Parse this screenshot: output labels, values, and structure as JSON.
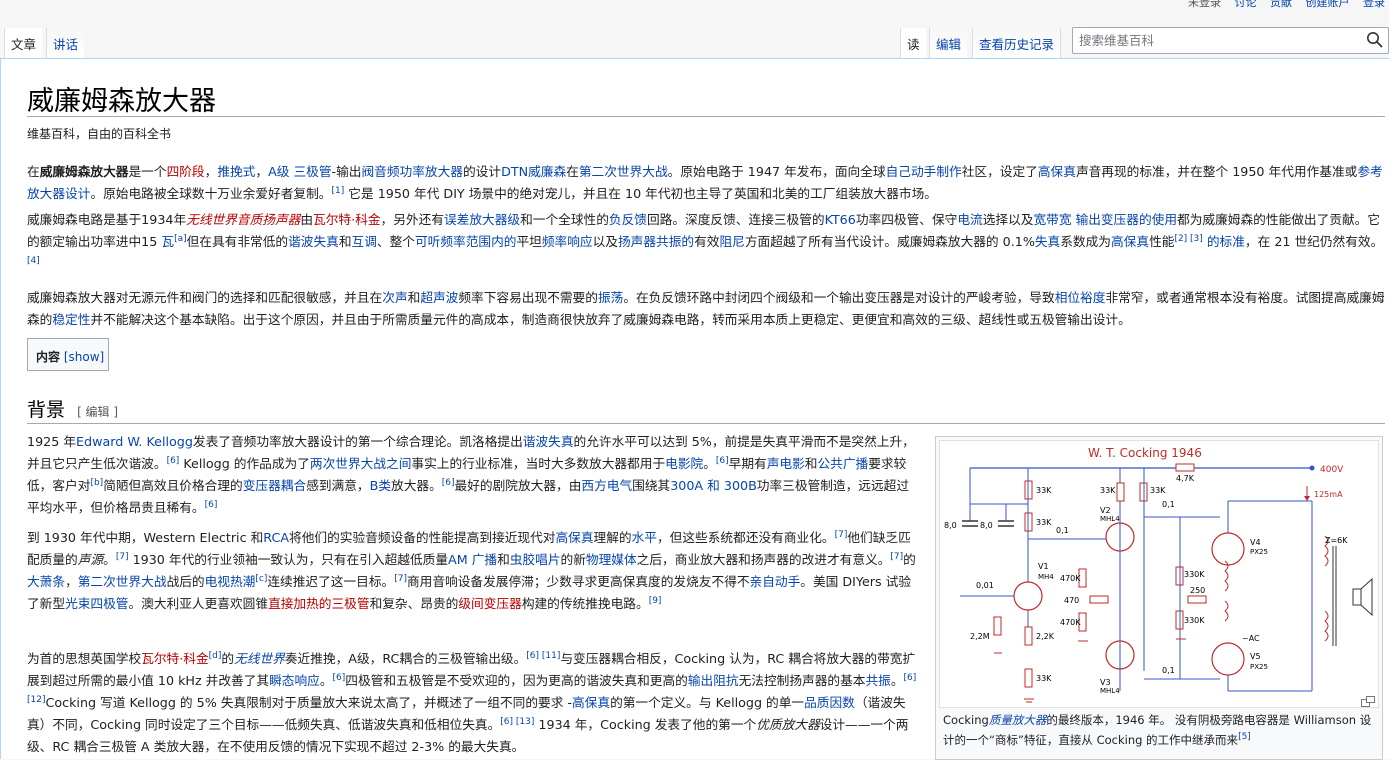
{
  "personal_tools": [
    "未登录",
    "讨论",
    "贡献",
    "创建账户",
    "登录"
  ],
  "tabs": {
    "article": "文章",
    "talk": "讲话",
    "read": "读",
    "edit": "编辑",
    "history": "查看历史记录"
  },
  "search": {
    "placeholder": "搜索维基百科"
  },
  "page": {
    "title": "威廉姆森放大器",
    "tagline": "维基百科，自由的百科全书"
  },
  "toc": {
    "label": "内容",
    "toggle": "[show]"
  },
  "section": {
    "title": "背景",
    "edit": "[ 编辑 ]"
  },
  "figure": {
    "diagram_title": "W. T. Cocking 1946",
    "caption_pre": "Cocking",
    "caption_em": "质量放大器",
    "caption_post": "的最终版本，1946 年。 没有阴极旁路电容器是 Williamson 设计的一个“商标”特征，直接从 Cocking 的工作中继承而来",
    "caption_ref": "[5]",
    "labels": {
      "v400": "400V",
      "ma125": "125mA",
      "k47": "4,7K",
      "z6k": "Z=6K",
      "ac": "~AC",
      "k33": "33K",
      "c01": "0,1",
      "c8": "8,0",
      "c001": "0,01",
      "r22m": "2,2M",
      "r22k": "2,2K",
      "k470": "470K",
      "r470": "470",
      "k330": "330K",
      "r250": "250",
      "v1": "V1",
      "mh4": "MH4",
      "v2": "V2",
      "v3": "V3",
      "v4": "V4",
      "v5": "V5",
      "px25": "PX25"
    }
  },
  "colors": {
    "link": "#0645ad",
    "redlink": "#ba0000",
    "circuit": "#c22a2a",
    "wire": "#3355cc"
  }
}
